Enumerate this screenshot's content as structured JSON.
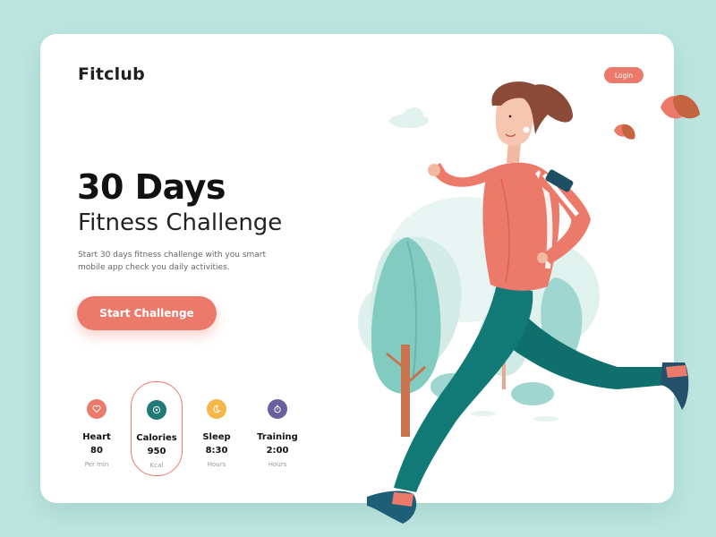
{
  "brand": {
    "name": "Fitclub"
  },
  "header": {
    "login_label": "Login"
  },
  "hero": {
    "title": "30 Days",
    "subtitle": "Fitness Challenge",
    "description": "Start 30 days fitness challenge with you smart mobile app check you daily activities.",
    "cta_label": "Start Challenge"
  },
  "stats": [
    {
      "label": "Heart",
      "value": "80",
      "unit": "Per min",
      "icon": "heart-icon",
      "color": "#ec7a6b"
    },
    {
      "label": "Calories",
      "value": "950",
      "unit": "Kcal",
      "icon": "target-icon",
      "color": "#1f7a78"
    },
    {
      "label": "Sleep",
      "value": "8:30",
      "unit": "Hours",
      "icon": "moon-icon",
      "color": "#f5b748"
    },
    {
      "label": "Training",
      "value": "2:00",
      "unit": "Hours",
      "icon": "stopwatch-icon",
      "color": "#6b5fa0"
    }
  ],
  "colors": {
    "background": "#bde6e0",
    "accent": "#ec7a6b",
    "teal": "#1f7a78",
    "text": "#111111"
  }
}
